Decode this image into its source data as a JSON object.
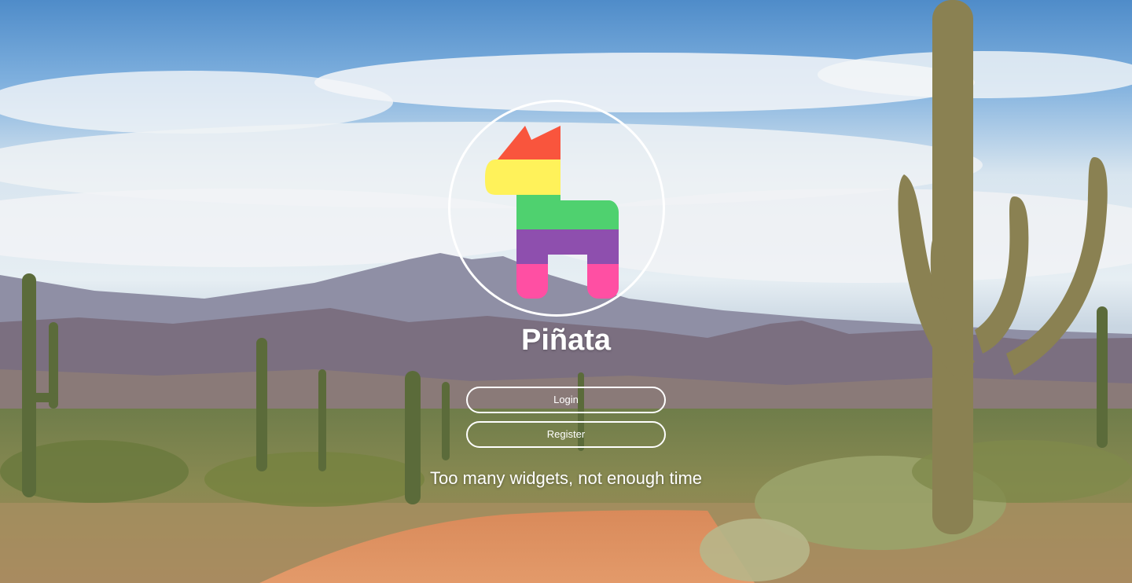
{
  "app": {
    "name": "Piñata",
    "tagline": "Too many widgets, not enough time"
  },
  "auth": {
    "login_label": "Login",
    "register_label": "Register"
  },
  "logo": {
    "icon": "pinata-llama-icon",
    "colors": {
      "ears": "#f9553d",
      "head": "#fff25a",
      "body": "#4fd16f",
      "belly": "#8e4fae",
      "legs": "#ff4fa3"
    }
  },
  "background": {
    "icon": "desert-landscape-image"
  }
}
